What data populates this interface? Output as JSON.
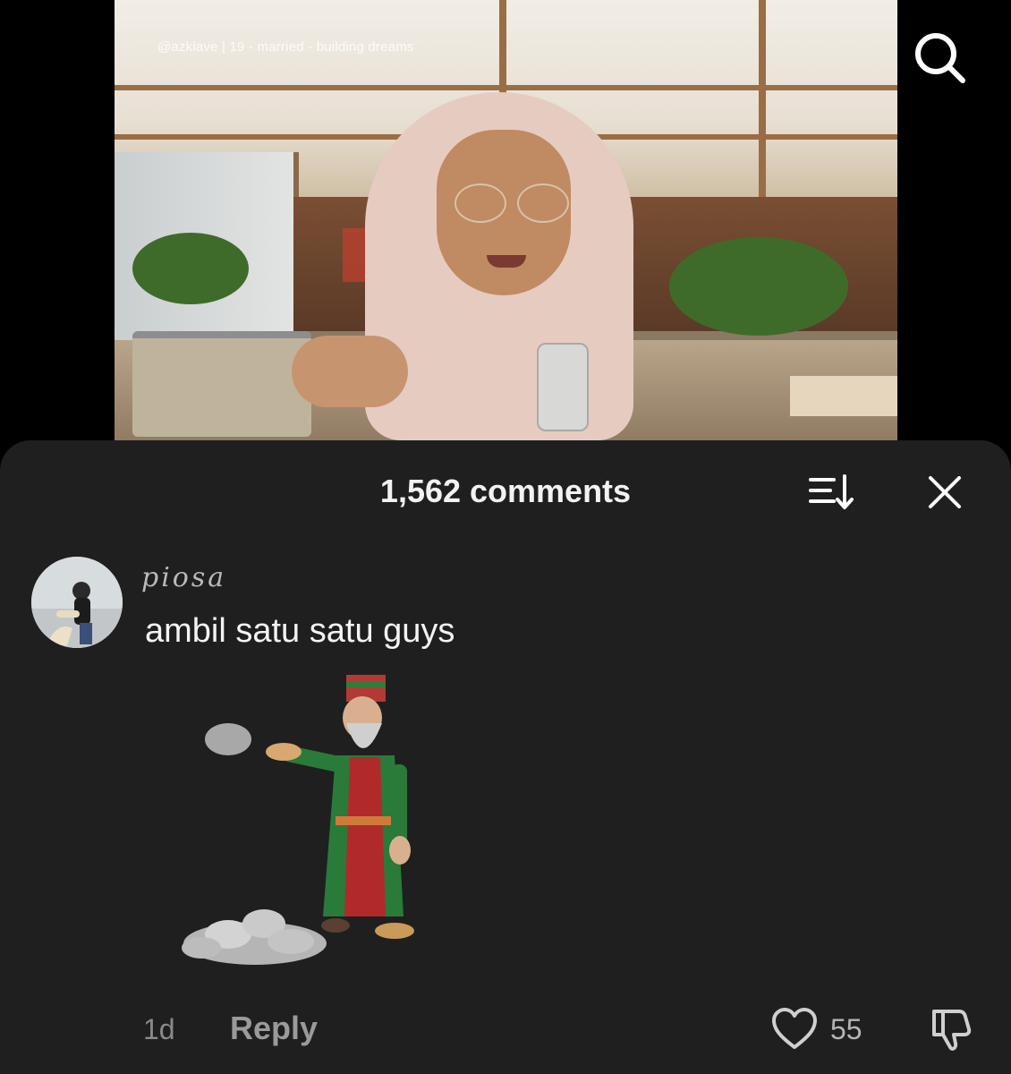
{
  "video": {
    "watermark": "@azklave | 19 - married - building dreams",
    "search_icon": "search-icon"
  },
  "comments_sheet": {
    "title": "1,562 comments",
    "sort_icon": "sort-icon",
    "close_icon": "close-icon",
    "comment": {
      "username": "piosa",
      "text": "ambil satu satu guys",
      "sticker": "animated-sticker-old-man-throwing-stones",
      "time": "1d",
      "reply_label": "Reply",
      "like_count": "55",
      "like_icon": "heart-icon",
      "dislike_icon": "thumbs-down-icon"
    }
  }
}
